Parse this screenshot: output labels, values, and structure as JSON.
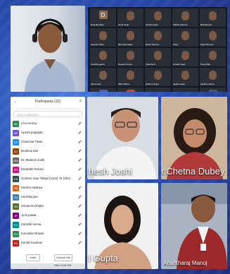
{
  "participants_panel": {
    "title": "Participants (32)",
    "search_placeholder": "Find a participant",
    "rows": [
      {
        "initials": "AV",
        "name": "Arvo verma",
        "color": "#2e8b57"
      },
      {
        "initials": "AP",
        "name": "Ayushi prajapati",
        "color": "#6a5acd"
      },
      {
        "initials": "CT",
        "name": "Chanchal Tiwari",
        "color": "#1e90ff"
      },
      {
        "initials": "DJ",
        "name": "Dudena Jain",
        "color": "#8b4513"
      },
      {
        "initials": "DM",
        "name": "Dr. Mahesh Joshi",
        "color": "#696969"
      },
      {
        "initials": "ER",
        "name": "Elizabeth Robert",
        "color": "#c71585"
      },
      {
        "initials": "GK",
        "name": "Gurleen Kaur Talwar (Liam) 76 (She)",
        "color": "#2f4f4f"
      },
      {
        "initials": "HA",
        "name": "Harsha Aaidriya",
        "color": "#d2691e"
      },
      {
        "initials": "HJ",
        "name": "Harshita jain",
        "color": "#4682b4"
      },
      {
        "initials": "HD",
        "name": "Himanshi Dhaba",
        "color": "#556b2f"
      },
      {
        "initials": "JP",
        "name": "Jyoti pawar",
        "color": "#800080"
      },
      {
        "initials": "KV",
        "name": "Kanishk verma",
        "color": "#008b8b"
      },
      {
        "initials": "KV",
        "name": "Komolika Ishwari",
        "color": "#2e8b57"
      },
      {
        "initials": "KK",
        "name": "Kuntal Kaushan",
        "color": "#b22222"
      }
    ],
    "invite_label": "Invite",
    "unmute_label": "Unmute Me",
    "taskbar_text": "ENG 12:52 PM"
  },
  "grid": {
    "cells": [
      {
        "name": "Deepika tiwari",
        "initial": "D",
        "color": "#8a6d4e"
      },
      {
        "name": "sonal singh",
        "initial": "",
        "color": ""
      },
      {
        "name": "Harsha singh",
        "initial": "",
        "color": ""
      },
      {
        "name": "Shikha Sharma",
        "initial": "",
        "color": ""
      },
      {
        "name": "Bhavika (G)",
        "initial": "",
        "color": ""
      },
      {
        "name": "Aarushi Yadav",
        "initial": "",
        "color": ""
      },
      {
        "name": "Bhumika Nagar",
        "initial": "",
        "color": ""
      },
      {
        "name": "Rahul Sharma",
        "initial": "",
        "color": ""
      },
      {
        "name": "Pinky",
        "initial": "",
        "color": ""
      },
      {
        "name": "Sujal Sharma",
        "initial": "",
        "color": ""
      },
      {
        "name": "Harshita gupta",
        "initial": "",
        "color": ""
      },
      {
        "name": "Deepak Verma",
        "initial": "",
        "color": ""
      },
      {
        "name": "Anantha S",
        "initial": "",
        "color": ""
      },
      {
        "name": "Himesh Kaur",
        "initial": "",
        "color": ""
      },
      {
        "name": "Priya Dhar",
        "initial": "",
        "color": ""
      },
      {
        "name": "Ashok Jain",
        "initial": "",
        "color": ""
      },
      {
        "name": "Mihir Mehta",
        "initial": "",
        "color": ""
      },
      {
        "name": "Rashmi Singh",
        "initial": "",
        "color": ""
      },
      {
        "name": "Jayati Gupta",
        "initial": "",
        "color": ""
      },
      {
        "name": "Nandini Verma",
        "initial": "",
        "color": ""
      },
      {
        "name": "Riya",
        "initial": "R",
        "color": "#4a5fb4"
      },
      {
        "name": "Tanya",
        "initial": "T",
        "color": "#c94a2a"
      },
      {
        "name": "",
        "initial": "",
        "color": ""
      },
      {
        "name": "",
        "initial": "",
        "color": ""
      },
      {
        "name": "",
        "initial": "A",
        "color": "#4c5a6e"
      }
    ]
  },
  "videos": {
    "v1_label": "hesh Joshi",
    "v2_label": "r.Chetna Dubey",
    "v3_label": "l Gupta",
    "v4_label": "Anantharaj Manoj"
  }
}
